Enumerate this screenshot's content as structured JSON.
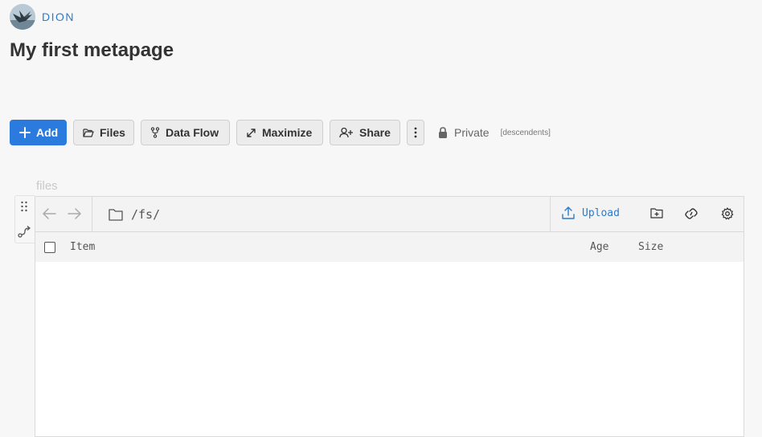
{
  "user": {
    "name": "DION",
    "avatar_icon": "bird-avatar-icon"
  },
  "page": {
    "title": "My first metapage"
  },
  "toolbar": {
    "add_label": "Add",
    "files_label": "Files",
    "dataflow_label": "Data Flow",
    "maximize_label": "Maximize",
    "share_label": "Share",
    "privacy_label": "Private",
    "privacy_sub": "[descendents]"
  },
  "panel": {
    "title": "files",
    "path": "/fs/",
    "upload_label": "Upload",
    "columns": {
      "item": "Item",
      "age": "Age",
      "size": "Size"
    },
    "rows": []
  },
  "colors": {
    "accent": "#2b7bdf",
    "link": "#2b7bd0",
    "background": "#f7f7f7",
    "toolbar_button": "#ececec"
  }
}
